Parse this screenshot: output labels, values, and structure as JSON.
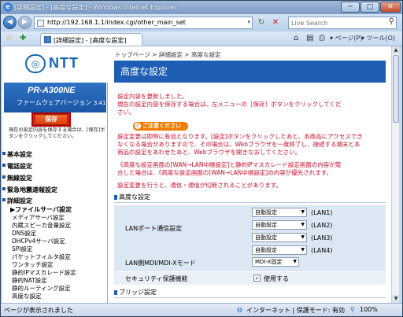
{
  "window": {
    "title": "[詳細設定] - [高度な設定] - Windows Internet Explorer",
    "min": "─",
    "max": "□",
    "close": "✕",
    "ie_glyph": "e"
  },
  "addressbar": {
    "url": "http://192.168.1.1/index.cgi/other_main_set",
    "search_placeholder": "Live Search",
    "back": "◀",
    "forward": "▶",
    "refresh": "↻",
    "stop": "✕",
    "search": "⚲",
    "dropdown": "▾"
  },
  "tabbar": {
    "tab_label": "[詳細設定] - [高度な設定]",
    "fav_star": "☆",
    "add_fav": "✚",
    "tools": [
      "⌂",
      "▤",
      "⎙",
      "▾ ページ(P)",
      "▾ ツール(O)"
    ]
  },
  "sidebar": {
    "logo_text": "NTT",
    "model": "PR-A300NE",
    "firmware_label": "ファームウェアバージョン",
    "firmware_version": "3.41",
    "save_button": "保存",
    "save_note": "現在の設定内容を保存する場合は、[保存]ボタンをクリックしてください。",
    "menu": [
      {
        "label": "基本設定",
        "type": "h"
      },
      {
        "label": "電話設定",
        "type": "h"
      },
      {
        "label": "無線設定",
        "type": "h"
      },
      {
        "label": "緊急地震速報設定",
        "type": "h"
      },
      {
        "label": "詳細設定",
        "type": "h"
      },
      {
        "label": "▶ファイルサーバ設定",
        "type": "sub"
      },
      {
        "label": "メディアサーバ設定",
        "type": "sub2"
      },
      {
        "label": "内蔵スピーカ音量設定",
        "type": "sub2"
      },
      {
        "label": "DNS設定",
        "type": "sub2"
      },
      {
        "label": "DHCPv4サーバ設定",
        "type": "sub2"
      },
      {
        "label": "SPI設定",
        "type": "sub2"
      },
      {
        "label": "パケットフィルタ設定",
        "type": "sub2"
      },
      {
        "label": "ワンタッチ設定",
        "type": "sub2"
      },
      {
        "label": "静的IPマスカレード設定",
        "type": "sub2"
      },
      {
        "label": "静的NAT設定",
        "type": "sub2"
      },
      {
        "label": "静的ルーティング設定",
        "type": "sub2"
      },
      {
        "label": "高度な設定",
        "type": "sub2"
      }
    ]
  },
  "main": {
    "breadcrumb": "トップページ > 詳細設定 > 高度な設定",
    "title": "高度な設定",
    "msg1": "設定内容を更新しました。",
    "msg2": "現在の設定内容を保存する場合は、左メニューの［保存］ボタンをクリックしてくだ",
    "msg3": "さい。",
    "caution_label": "ご注意ください",
    "caution_lines": [
      "設定変更は即時に有効となります。[設定]ボタンをクリックしたあと、本商品にアクセスでき",
      "なくなる場合がありますので、その場合は、Webブラウザを一度終了し、接続する端末と本",
      "商品の設定をあわせたあと、Webブラウザを開きなおしてください。"
    ],
    "warn_lines": [
      "《高度な設定画面の[WAN→LAN中継設定]と静的IPマスカレード設定画面の内容が競",
      "合した場合は、《高度な設定画面の[WAN→LAN中継設定]の内容が優先されます。"
    ],
    "notice": "設定変更を行うと、通信・通信が切断されることがあります。",
    "section1": "高度な設定",
    "lan_label": "LANポート通信設定",
    "lan_ports": [
      {
        "value": "自動設定",
        "port": "(LAN1)"
      },
      {
        "value": "自動設定",
        "port": "(LAN2)"
      },
      {
        "value": "自動設定",
        "port": "(LAN3)"
      },
      {
        "value": "自動設定",
        "port": "(LAN4)"
      }
    ],
    "mdi_label": "LAN側MDI/MDI-Xモード",
    "mdi_value": "MDI-X固定",
    "security_label": "セキュリティ保護機能",
    "security_check": "✓",
    "security_text": "使用する",
    "section2": "ブリッジ設定"
  },
  "statusbar": {
    "left": "ページが表示されました",
    "zone": "インターネット | 保護モード: 有効",
    "zoom": "100%"
  }
}
